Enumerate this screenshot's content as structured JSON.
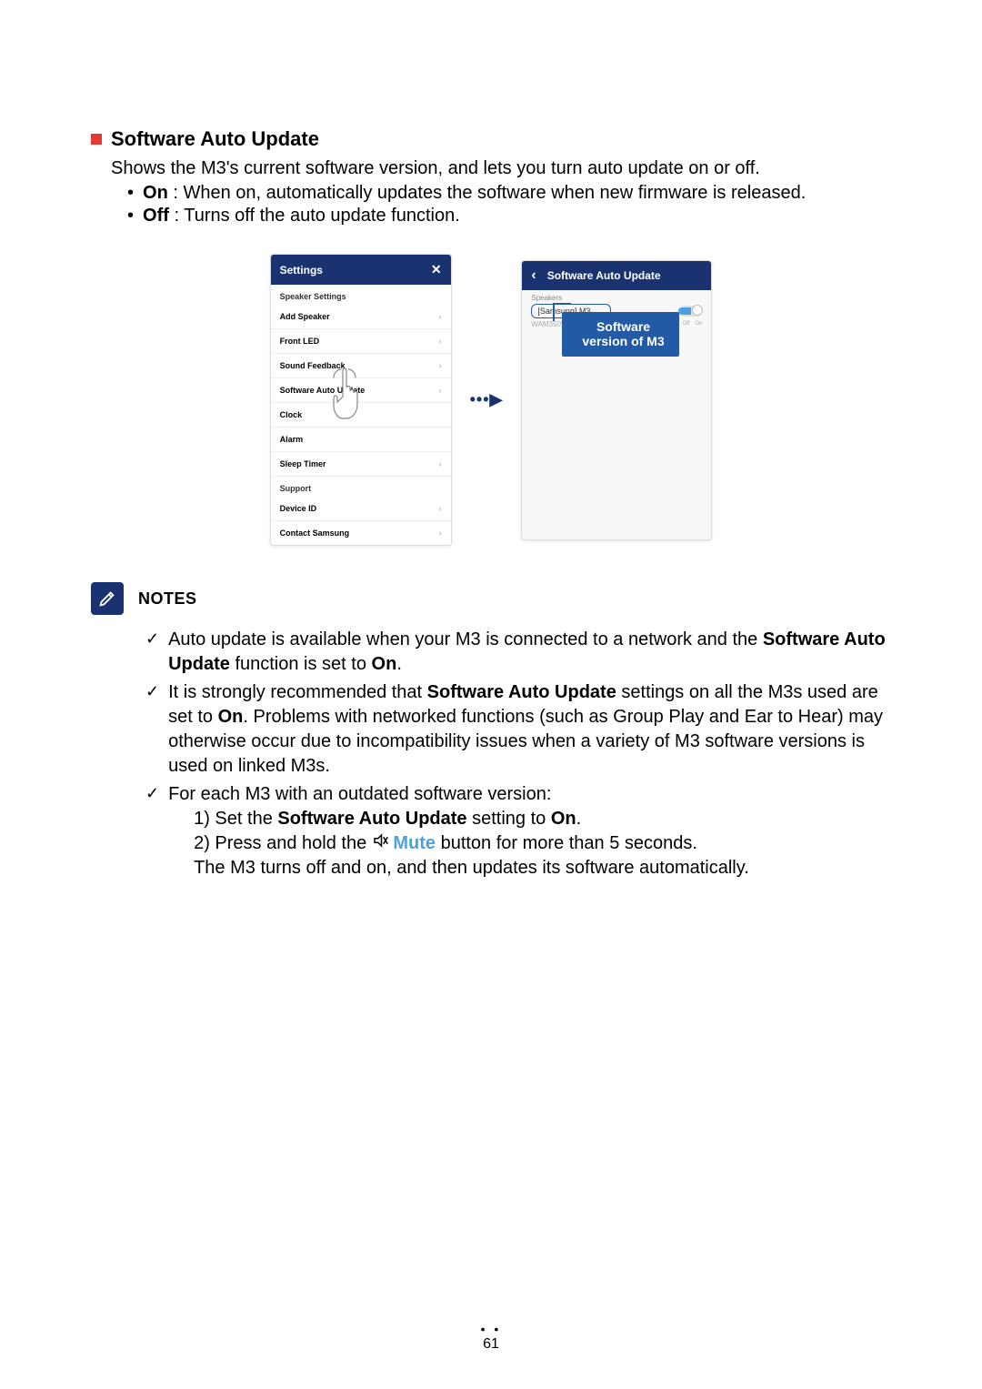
{
  "section": {
    "title": "Software Auto Update",
    "description": "Shows the M3's current software version, and lets you turn auto update on or off.",
    "bullet_on_label": "On",
    "bullet_on_text": " : When on, automatically updates the software when new firmware is released.",
    "bullet_off_label": "Off",
    "bullet_off_text": " : Turns off the auto update function."
  },
  "settings_screen": {
    "title": "Settings",
    "sections": {
      "speaker_settings": "Speaker Settings",
      "support": "Support"
    },
    "items": {
      "add_speaker": "Add Speaker",
      "front_led": "Front LED",
      "sound_feedback": "Sound Feedback",
      "software_auto_update": "Software Auto Update",
      "clock": "Clock",
      "alarm": "Alarm",
      "sleep_timer": "Sleep Timer",
      "device_id": "Device ID",
      "contact_samsung": "Contact Samsung"
    }
  },
  "update_screen": {
    "title": "Software Auto Update",
    "speakers_label": "Speakers",
    "speaker_name": "[Samsung] M3",
    "version": "WAM350WWB-2007.2",
    "off": "Off",
    "on": "On",
    "callout_line1": "Software",
    "callout_line2": "version of M3"
  },
  "notes": {
    "title": "NOTES",
    "item1_a": "Auto update is available when your M3 is connected to a network and the ",
    "item1_b": "Software Auto Update",
    "item1_c": " function is set to ",
    "item1_d": "On",
    "item1_e": ".",
    "item2_a": "It is strongly recommended that ",
    "item2_b": "Software Auto Update",
    "item2_c": " settings on all the M3s used are set to ",
    "item2_d": "On",
    "item2_e": ". Problems with networked functions (such as Group Play and Ear to Hear) may otherwise occur due to incompatibility issues when a variety of M3 software versions is used on linked M3s.",
    "item3": "For each M3 with an outdated software version:",
    "step1_a": "1) Set the ",
    "step1_b": "Software Auto Update",
    "step1_c": " setting to ",
    "step1_d": "On",
    "step1_e": ".",
    "step2_a": "2) Press and hold the ",
    "step2_mute": "Mute",
    "step2_b": " button for more than 5 seconds.",
    "step_result": "The M3 turns off and on, and then updates its software automatically."
  },
  "page_number": "61"
}
